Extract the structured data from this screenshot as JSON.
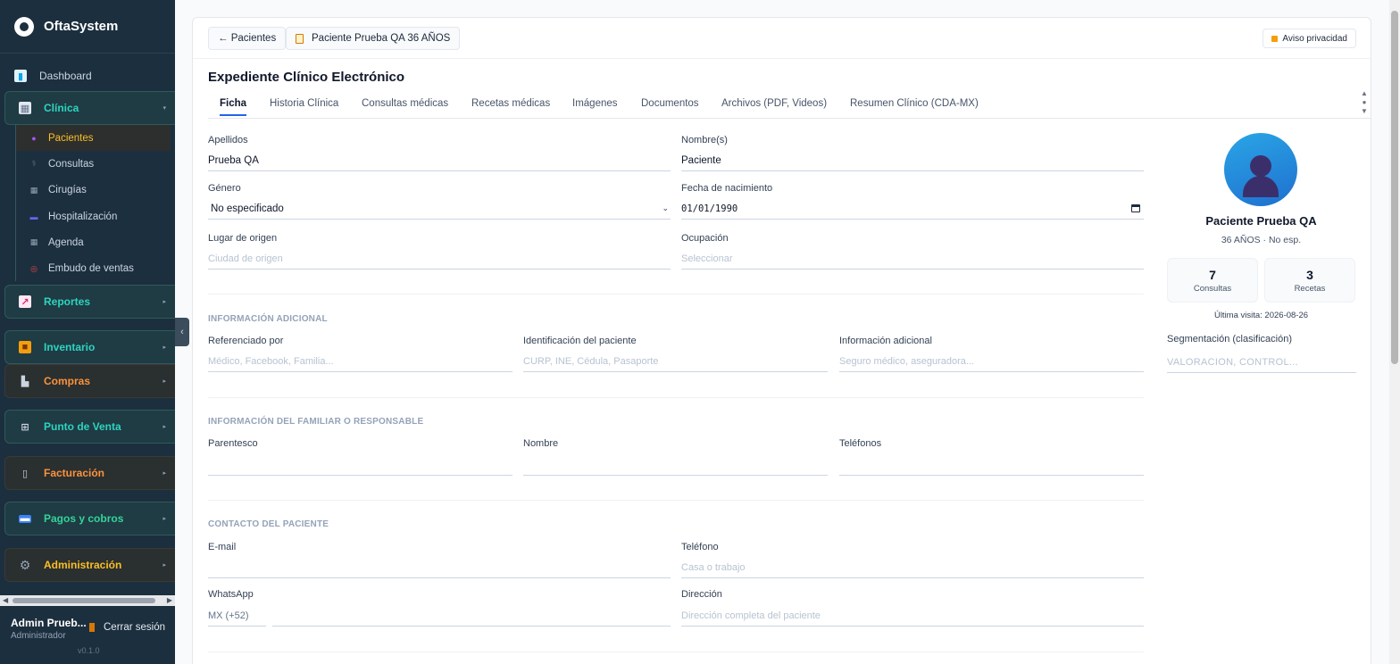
{
  "app": {
    "name": "OftaSystem",
    "version": "v0.1.0"
  },
  "sidebar": {
    "dashboard": "Dashboard",
    "clinica": {
      "label": "Clínica",
      "color": "#2dd4bf",
      "bg": "#1f3b44",
      "border": "#2f5a5a"
    },
    "clinica_items": [
      {
        "label": "Pacientes",
        "active": true
      },
      {
        "label": "Consultas"
      },
      {
        "label": "Cirugías"
      },
      {
        "label": "Hospitalización"
      },
      {
        "label": "Agenda"
      },
      {
        "label": "Embudo de ventas"
      }
    ],
    "groups": [
      {
        "label": "Reportes",
        "color": "#2dd4bf",
        "bg": "#1f3b44",
        "border": "#2f5a5a"
      },
      {
        "label": "Inventario",
        "color": "#2dd4bf",
        "bg": "#1f3b44",
        "border": "#2f5a5a"
      },
      {
        "label": "Compras",
        "color": "#fb923c",
        "bg": "#2a2f30",
        "border": "#3a3a36"
      },
      {
        "label": "Punto de Venta",
        "color": "#2dd4bf",
        "bg": "#1f3b44",
        "border": "#2f5a5a"
      },
      {
        "label": "Facturación",
        "color": "#fb923c",
        "bg": "#2a2f30",
        "border": "#3a3a36"
      },
      {
        "label": "Pagos y cobros",
        "color": "#34d399",
        "bg": "#1f3b44",
        "border": "#2f5a5a"
      },
      {
        "label": "Administración",
        "color": "#fbbf24",
        "bg": "#2a2f30",
        "border": "#3a3a36"
      }
    ],
    "user": {
      "name": "Admin Prueb...",
      "role": "Administrador",
      "logout": "Cerrar sesión"
    }
  },
  "topbar": {
    "back": "← Pacientes",
    "patient_tab": "Paciente Prueba QA 36 AÑOS",
    "privacy": "Aviso privacidad"
  },
  "expediente": {
    "title": "Expediente Clínico Electrónico",
    "tabs": [
      "Ficha",
      "Historia Clínica",
      "Consultas médicas",
      "Recetas médicas",
      "Imágenes",
      "Documentos",
      "Archivos (PDF, Videos)",
      "Resumen Clínico (CDA-MX)"
    ]
  },
  "form": {
    "apellidos": {
      "label": "Apellidos",
      "value": "Prueba QA"
    },
    "nombres": {
      "label": "Nombre(s)",
      "value": "Paciente"
    },
    "genero": {
      "label": "Género",
      "value": "No especificado"
    },
    "nacimiento": {
      "label": "Fecha de nacimiento",
      "value": "01/01/1990"
    },
    "origen": {
      "label": "Lugar de origen",
      "placeholder": "Ciudad de origen"
    },
    "ocupacion": {
      "label": "Ocupación",
      "placeholder": "Seleccionar"
    },
    "adicional_title": "INFORMACIÓN ADICIONAL",
    "referenciado": {
      "label": "Referenciado por",
      "placeholder": "Médico, Facebook, Familia..."
    },
    "identificacion": {
      "label": "Identificación del paciente",
      "placeholder": "CURP, INE, Cédula, Pasaporte"
    },
    "info_adicional": {
      "label": "Información adicional",
      "placeholder": "Seguro médico, aseguradora..."
    },
    "familiar_title": "INFORMACIÓN DEL FAMILIAR O RESPONSABLE",
    "parentesco": {
      "label": "Parentesco"
    },
    "nombre_fam": {
      "label": "Nombre"
    },
    "telefonos": {
      "label": "Teléfonos"
    },
    "contacto_title": "CONTACTO DEL PACIENTE",
    "email": {
      "label": "E-mail"
    },
    "telefono": {
      "label": "Teléfono",
      "placeholder": "Casa o trabajo"
    },
    "whatsapp": {
      "label": "WhatsApp",
      "prefix": "MX (+52)"
    },
    "direccion": {
      "label": "Dirección",
      "placeholder": "Dirección completa del paciente"
    }
  },
  "profile": {
    "name": "Paciente Prueba QA",
    "age": "36 AÑOS · No esp.",
    "stats": [
      {
        "value": "7",
        "label": "Consultas"
      },
      {
        "value": "3",
        "label": "Recetas"
      }
    ],
    "last_visit": "Última visita: 2026-08-26",
    "segmentacion": {
      "label": "Segmentación (clasificación)",
      "placeholder": "VALORACION, CONTROL..."
    }
  }
}
